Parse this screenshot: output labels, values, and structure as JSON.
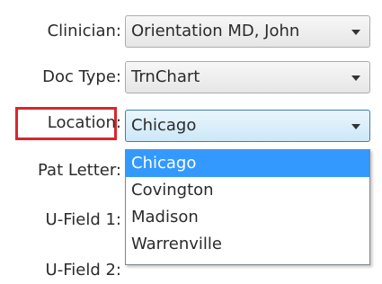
{
  "form": {
    "clinician": {
      "label": "Clinician:",
      "value": "Orientation MD, John"
    },
    "doc_type": {
      "label": "Doc Type:",
      "value": "TrnChart"
    },
    "location": {
      "label": "Location:",
      "value": "Chicago",
      "options": [
        "Chicago",
        "Covington",
        "Madison",
        "Warrenville"
      ]
    },
    "pat_letter": {
      "label": "Pat Letter:"
    },
    "u_field_1": {
      "label": "U-Field 1:"
    },
    "u_field_2": {
      "label": "U-Field 2:"
    }
  },
  "colors": {
    "highlight_border": "#d9262b",
    "selected_option": "#3399ff",
    "active_combo_border": "#3c7fb1"
  },
  "icons": {
    "combo_arrow": "chevron-down-icon"
  }
}
